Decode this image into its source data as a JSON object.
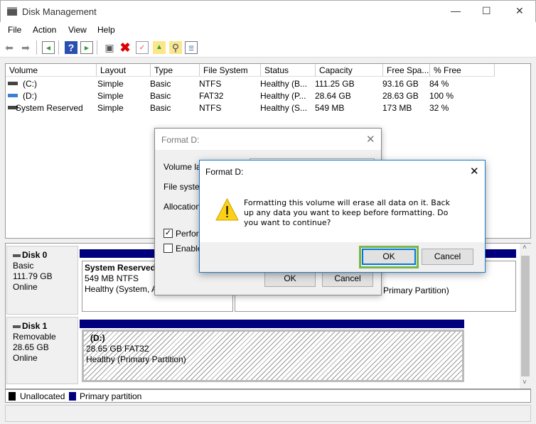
{
  "window": {
    "title": "Disk Management"
  },
  "menu": [
    "File",
    "Action",
    "View",
    "Help"
  ],
  "toolbar": [
    "back-icon",
    "forward-icon",
    "console-tree-icon",
    "help-icon",
    "action-pane-icon",
    "connect-disk-icon",
    "delete-icon",
    "properties-icon",
    "open-icon",
    "explore-icon",
    "settings-icon"
  ],
  "volumes": {
    "columns": [
      "Volume",
      "Layout",
      "Type",
      "File System",
      "Status",
      "Capacity",
      "Free Spa...",
      "% Free"
    ],
    "rows": [
      [
        "(C:)",
        "Simple",
        "Basic",
        "NTFS",
        "Healthy (B...",
        "111.25 GB",
        "93.16 GB",
        "84 %"
      ],
      [
        "(D:)",
        "Simple",
        "Basic",
        "FAT32",
        "Healthy (P...",
        "28.64 GB",
        "28.63 GB",
        "100 %"
      ],
      [
        "System Reserved",
        "Simple",
        "Basic",
        "NTFS",
        "Healthy (S...",
        "549 MB",
        "173 MB",
        "32 %"
      ]
    ]
  },
  "disks": [
    {
      "name": "Disk 0",
      "type": "Basic",
      "size": "111.79 GB",
      "state": "Online",
      "partitions": [
        {
          "name": "System Reserved",
          "detail": "549 MB NTFS",
          "status": "Healthy (System, A"
        },
        {
          "name": "",
          "detail": "",
          "status": "Primary Partition)"
        }
      ]
    },
    {
      "name": "Disk 1",
      "type": "Removable",
      "size": "28.65 GB",
      "state": "Online",
      "partitions": [
        {
          "name": "(D:)",
          "detail": "28.65 GB FAT32",
          "status": "Healthy (Primary Partition)"
        }
      ]
    }
  ],
  "legend": {
    "unallocated": "Unallocated",
    "primary": "Primary partition",
    "unallocated_color": "#000000",
    "primary_color": "#00007f"
  },
  "format_dialog": {
    "title": "Format D:",
    "volume_label": "Volume lab",
    "file_system": "File system",
    "allocation": "Allocation u",
    "quick_format": "Perform",
    "quick_format_checked": true,
    "compression": "Enable",
    "compression_checked": false,
    "ok": "OK",
    "cancel": "Cancel"
  },
  "confirm_dialog": {
    "title": "Format D:",
    "message": "Formatting this volume will erase all data on it. Back up any data you want to keep before formatting. Do you want to continue?",
    "ok": "OK",
    "cancel": "Cancel",
    "highlight_color": "#7ab648"
  }
}
